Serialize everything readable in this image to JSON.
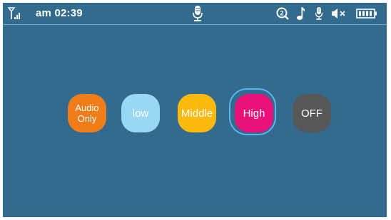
{
  "status_bar": {
    "time": "am 02:39",
    "icons": [
      "signal-icon",
      "microphone-icon",
      "search-2-icon",
      "music-note-icon",
      "microphone-small-icon",
      "mute-icon",
      "battery-icon"
    ]
  },
  "modes": {
    "audio_only": "Audio Only",
    "low": "low",
    "middle": "Middle",
    "high": "High",
    "off": "OFF",
    "selected": "High"
  },
  "colors": {
    "background": "#336b8f",
    "audio_only": "#f07c1a",
    "low": "#99d8f5",
    "middle": "#fdb90e",
    "high": "#e8117a",
    "off": "#555758",
    "selection_ring": "#5cb2ee"
  }
}
